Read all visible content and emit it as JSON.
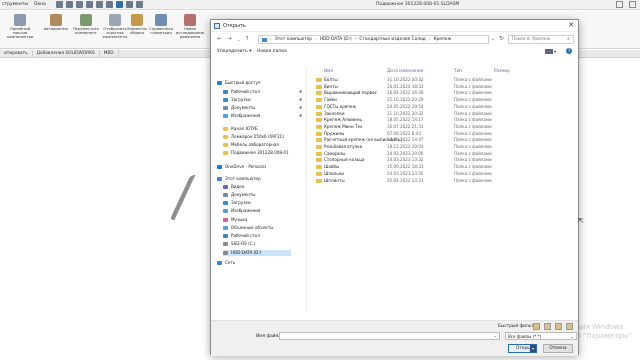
{
  "app": {
    "menus": [
      "струменты",
      "Окно"
    ],
    "document_title": "Подвижное 301228.008-01.SLDASM",
    "tools": [
      "Линейный массив компонентов",
      "Автокрепеж",
      "Переместить компонент",
      "Отобразить скрытые компоненты",
      "Элементы сборки",
      "Справочная геометрия",
      "Новое исследование движения"
    ],
    "command_tabs": [
      "итировать",
      "Добавления SOLIDWORKS",
      "MBD"
    ],
    "watermark_line1": "ация Windows",
    "watermark_line2": "ел \"Параметры\""
  },
  "dialog": {
    "title": "Открыть",
    "breadcrumb": [
      "Этот компьютер",
      "HDD-DATA (D:)",
      "Стандартные изделия Солид",
      "Крепеж"
    ],
    "search_placeholder": "Поиск в: Крепеж",
    "organize": "Упорядочить ▾",
    "new_folder": "Новая папка",
    "columns": {
      "name": "Имя",
      "date": "Дата изменения",
      "type": "Тип",
      "size": "Размер"
    },
    "nav_items": [
      {
        "label": "Быстрый доступ",
        "pin": false,
        "icon": "star"
      },
      {
        "label": "Рабочий стол",
        "pin": true,
        "icon": "desktop"
      },
      {
        "label": "Загрузки",
        "pin": true,
        "icon": "download"
      },
      {
        "label": "Документы",
        "pin": true,
        "icon": "document"
      },
      {
        "label": "Изображения",
        "pin": true,
        "icon": "pictures"
      },
      {
        "label": "Канал ЮТУБ",
        "pin": false,
        "icon": "folder"
      },
      {
        "label": "Ломкарон 250х6 (09Г2С)",
        "pin": false,
        "icon": "folder"
      },
      {
        "label": "Мебель лабораторная",
        "pin": false,
        "icon": "folder"
      },
      {
        "label": "Подвижное 301228.008-01",
        "pin": false,
        "icon": "folder"
      },
      {
        "label": "OneDrive - Personal",
        "pin": false,
        "icon": "cloud"
      },
      {
        "label": "Этот компьютер",
        "pin": false,
        "icon": "pc"
      },
      {
        "label": "Видео",
        "pin": false,
        "icon": "video"
      },
      {
        "label": "Документы",
        "pin": false,
        "icon": "document"
      },
      {
        "label": "Загрузки",
        "pin": false,
        "icon": "download"
      },
      {
        "label": "Изображения",
        "pin": false,
        "icon": "pictures"
      },
      {
        "label": "Музыка",
        "pin": false,
        "icon": "music"
      },
      {
        "label": "Объемные объекты",
        "pin": false,
        "icon": "3d"
      },
      {
        "label": "Рабочий стол",
        "pin": false,
        "icon": "desktop"
      },
      {
        "label": "SSD-OS (C:)",
        "pin": false,
        "icon": "drive"
      },
      {
        "label": "HDD-DATA (D:)",
        "pin": false,
        "icon": "drive",
        "selected": true
      },
      {
        "label": "Сеть",
        "pin": false,
        "icon": "network"
      }
    ],
    "files": [
      {
        "name": "Болты",
        "date": "31.10.2022 20:32",
        "type": "Папка с файлами"
      },
      {
        "name": "Винты",
        "date": "26.01.2024 18:33",
        "type": "Папка с файлами"
      },
      {
        "name": "Выравнивающий подвес",
        "date": "26.04.2022 16:36",
        "type": "Папка с файлами"
      },
      {
        "name": "Гайки",
        "date": "21.10.2022 20:29",
        "type": "Папка с файлами"
      },
      {
        "name": "ГОСТы крепеж",
        "date": "24.05.2022 19:54",
        "type": "Папка с файлами"
      },
      {
        "name": "Заклепки",
        "date": "21.10.2022 20:32",
        "type": "Папка с файлами"
      },
      {
        "name": "Крепеж Алюминь",
        "date": "18.05.2022 14:17",
        "type": "Папка с файлами"
      },
      {
        "name": "Крепеж Мини Тех",
        "date": "30.07.2022 21:31",
        "type": "Папка с файлами"
      },
      {
        "name": "Пружины",
        "date": "07.08.2022 8:43",
        "type": "Папка с файлами"
      },
      {
        "name": "Расчетный крепеж (не выписывать)",
        "date": "04.06.2022 14:47",
        "type": "Папка с файлами"
      },
      {
        "name": "Резьбовая втулка",
        "date": "18.12.2022 19:04",
        "type": "Папка с файлами"
      },
      {
        "name": "Саморезы",
        "date": "24.03.2023 20:00",
        "type": "Папка с файлами"
      },
      {
        "name": "Стопорные кольца",
        "date": "24.03.2023 13:32",
        "type": "Папка с файлами"
      },
      {
        "name": "Шайбы",
        "date": "15.09.2022 18:33",
        "type": "Папка с файлами"
      },
      {
        "name": "Шпильки",
        "date": "24.03.2023 13:35",
        "type": "Папка с файлами"
      },
      {
        "name": "Шплинты",
        "date": "05.04.2022 13:31",
        "type": "Папка с файлами"
      }
    ],
    "quick_filter_label": "Быстрый фильтр:",
    "file_name_label": "Имя файла:",
    "file_name_value": "",
    "file_type": "Все файлы (*.*)",
    "open_button": "Открыть",
    "cancel_button": "Отмена"
  },
  "colors": {
    "accent": "#2b6cb0",
    "folder": "#e9c24b",
    "selection": "#cde3f8"
  }
}
